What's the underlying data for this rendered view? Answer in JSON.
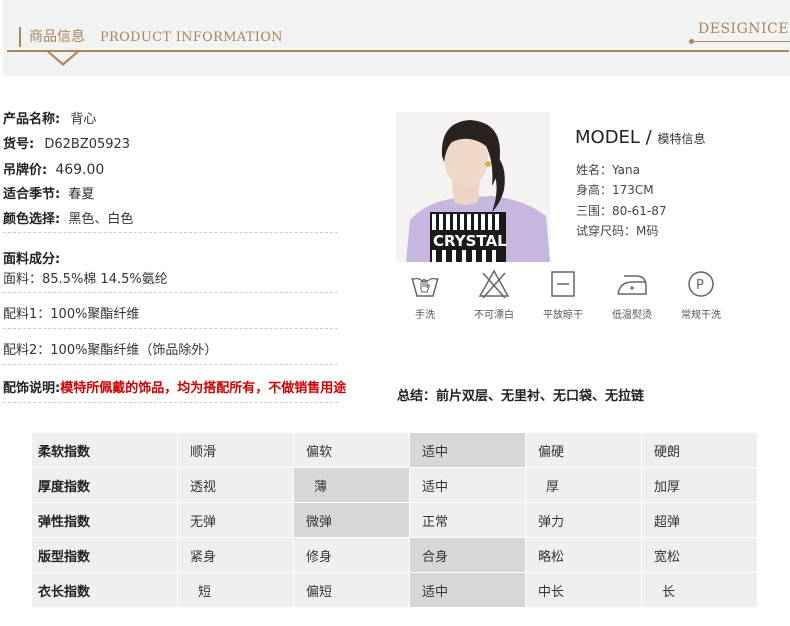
{
  "header": {
    "title_cn": "商品信息",
    "title_en": "PRODUCT INFORMATION",
    "brand": "DESIGNICE"
  },
  "product": {
    "name_label": "产品名称:",
    "name_value": "背心",
    "sku_label": "货号:",
    "sku_value": "D62BZ05923",
    "price_label": "吊牌价:",
    "price_value": "469.00",
    "season_label": "适合季节:",
    "season_value": "春夏",
    "color_label": "颜色选择:",
    "color_value": "黑色、白色",
    "fabric_label": "面料成分:",
    "fabric_main": "面料：85.5%棉 14.5%氨纶",
    "lining1": "配料1：100%聚酯纤维",
    "lining2": "配料2：100%聚酯纤维（饰品除外）",
    "accessory_label": "配饰说明:",
    "accessory_note": "模特所佩戴的饰品，均为搭配所有，不做销售用途"
  },
  "model": {
    "title": "MODEL /",
    "title_sub": "模特信息",
    "name": "姓名：Yana",
    "height": "身高：173CM",
    "measurements": "三围：80-61-87",
    "size": "试穿尺码：M码",
    "shirt_text": "CRYSTAL"
  },
  "care": [
    {
      "icon": "hand-wash-icon",
      "label": "手洗"
    },
    {
      "icon": "no-bleach-icon",
      "label": "不可漂白"
    },
    {
      "icon": "flat-dry-icon",
      "label": "平放晾干"
    },
    {
      "icon": "low-iron-icon",
      "label": "低温熨烫"
    },
    {
      "icon": "dry-clean-icon",
      "label": "常规干洗"
    }
  ],
  "summary": "总结：前片双层、无里衬、无口袋、无拉链",
  "index_table": {
    "rows": [
      {
        "name": "柔软指数",
        "options": [
          "顺滑",
          "偏软",
          "适中",
          "偏硬",
          "硬朗"
        ],
        "selected": 2
      },
      {
        "name": "厚度指数",
        "options": [
          "透视",
          "薄",
          "适中",
          "厚",
          "加厚"
        ],
        "selected": 1
      },
      {
        "name": "弹性指数",
        "options": [
          "无弹",
          "微弹",
          "正常",
          "弹力",
          "超弹"
        ],
        "selected": 1
      },
      {
        "name": "版型指数",
        "options": [
          "紧身",
          "修身",
          "合身",
          "略松",
          "宽松"
        ],
        "selected": 2
      },
      {
        "name": "衣长指数",
        "options": [
          "短",
          "偏短",
          "适中",
          "中长",
          "长"
        ],
        "selected": 2
      }
    ]
  },
  "colors": {
    "accent": "#a8875a",
    "highlight_cell": "#d7d7d7",
    "cell": "#efefef",
    "warning": "#d00000"
  }
}
